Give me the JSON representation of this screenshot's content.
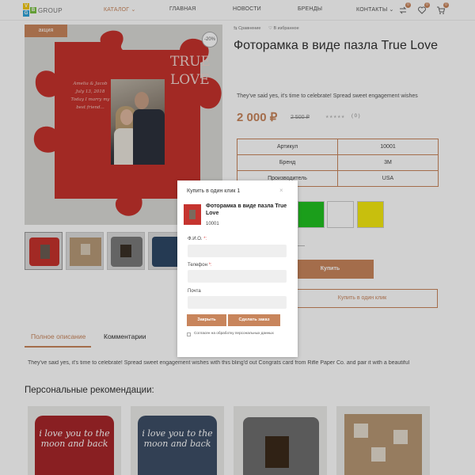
{
  "header": {
    "logo_letters": [
      "V",
      "G",
      "B"
    ],
    "logo_text": "GROUP",
    "nav": [
      "КАТАЛОГ",
      "ГЛАВНАЯ",
      "НОВОСТИ",
      "БРЕНДЫ",
      "КОНТАКТЫ"
    ],
    "compare_count": "0",
    "wishlist_count": "0",
    "cart_count": "0"
  },
  "product": {
    "sale_label": "акция",
    "discount": "-20%",
    "image_caption_lines": [
      "Amelia & Jacob",
      "July 13, 2018",
      "Today I marry my",
      "best friend..."
    ],
    "image_title": "TRUE LOVE",
    "compare_label": "Сравнение",
    "favorite_label": "В избранное",
    "title": "Фоторамка в виде пазла True Love",
    "short_desc": "They've said yes, it's time to celebrate! Spread sweet engagement wishes",
    "price": "2 000 ₽",
    "old_price": "2 500 ₽",
    "rating_stars": "★★★★★",
    "rating_count": "( 0 )",
    "specs": [
      {
        "label": "Артикул",
        "value": "10001"
      },
      {
        "label": "Бренд",
        "value": "3M"
      },
      {
        "label": "Производитель",
        "value": "USA"
      }
    ],
    "swatch_colors": [
      "#ce8761",
      "#21c121",
      "#ffffff",
      "#f4ea10"
    ],
    "buy_label": "Купить",
    "one_click_label": "Купить в один клик"
  },
  "tabs": [
    "Полное описание",
    "Комментарии"
  ],
  "full_description": "They've said yes, it's time to celebrate! Spread sweet engagement wishes with this bling'd out Congrats card from Rifle Paper Co. and pair it with a beautiful",
  "recommendations": {
    "title": "Персональные рекомендации:",
    "pillow_text": "i love you to the moon and back"
  },
  "modal": {
    "title": "Купить в один клик 1",
    "close": "×",
    "product_name": "Фоторамка в виде пазла True Love",
    "product_code": "10001",
    "name_label": "Ф.И.О.",
    "phone_label": "Телефон",
    "email_label": "Почта",
    "required_mark": "*:",
    "close_button": "Закрыть",
    "order_button": "Сделать заказ",
    "consent": "Согласен на обработку персональных данных"
  },
  "colors": {
    "accent": "#c8855c",
    "puzzle_red": "#c6322d"
  }
}
